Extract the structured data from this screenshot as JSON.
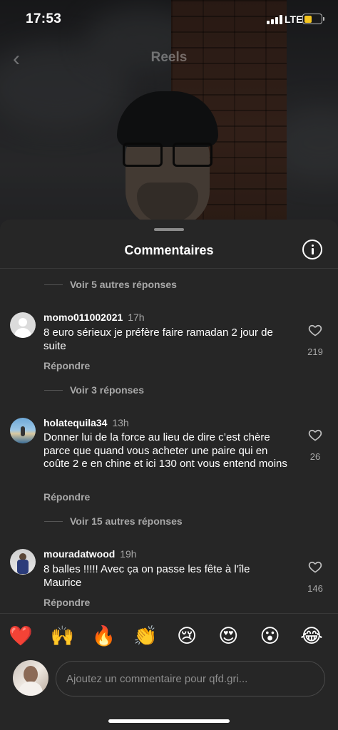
{
  "status_bar": {
    "time": "17:53",
    "network": "LTE"
  },
  "nav": {
    "title": "Reels"
  },
  "sheet": {
    "title": "Commentaires"
  },
  "threads": [
    {
      "replies_label": "Voir 5 autres réponses"
    },
    {
      "comment": {
        "username": "momo011002021",
        "time": "17h",
        "text": "8 euro sérieux je préfère faire ramadan  2 jour de suite",
        "reply_label": "Répondre",
        "likes": "219"
      },
      "replies_label": "Voir 3 réponses"
    },
    {
      "comment": {
        "username": "holatequila34",
        "time": "13h",
        "text": "Donner lui de la force au lieu de dire c’est chère parce que quand vous acheter une paire qui en coûte 2 e en chine et ici 130 ont vous entend moins",
        "reply_label": "Répondre",
        "likes": "26"
      },
      "replies_label": "Voir 15 autres réponses"
    },
    {
      "comment": {
        "username": "mouradatwood",
        "time": "19h",
        "text": "8 balles !!!!! Avec ça on passe les fête à l'île Maurice",
        "reply_label": "Répondre",
        "likes": "146"
      }
    }
  ],
  "reactions": [
    "❤️",
    "🙌",
    "🔥",
    "👏",
    "😢",
    "😍",
    "😮",
    "😂"
  ],
  "compose": {
    "placeholder": "Ajoutez un commentaire pour qfd.gri..."
  },
  "colors": {
    "sheet_bg": "#262626",
    "muted_text": "#a8a8a8",
    "battery": "#f4c520"
  }
}
